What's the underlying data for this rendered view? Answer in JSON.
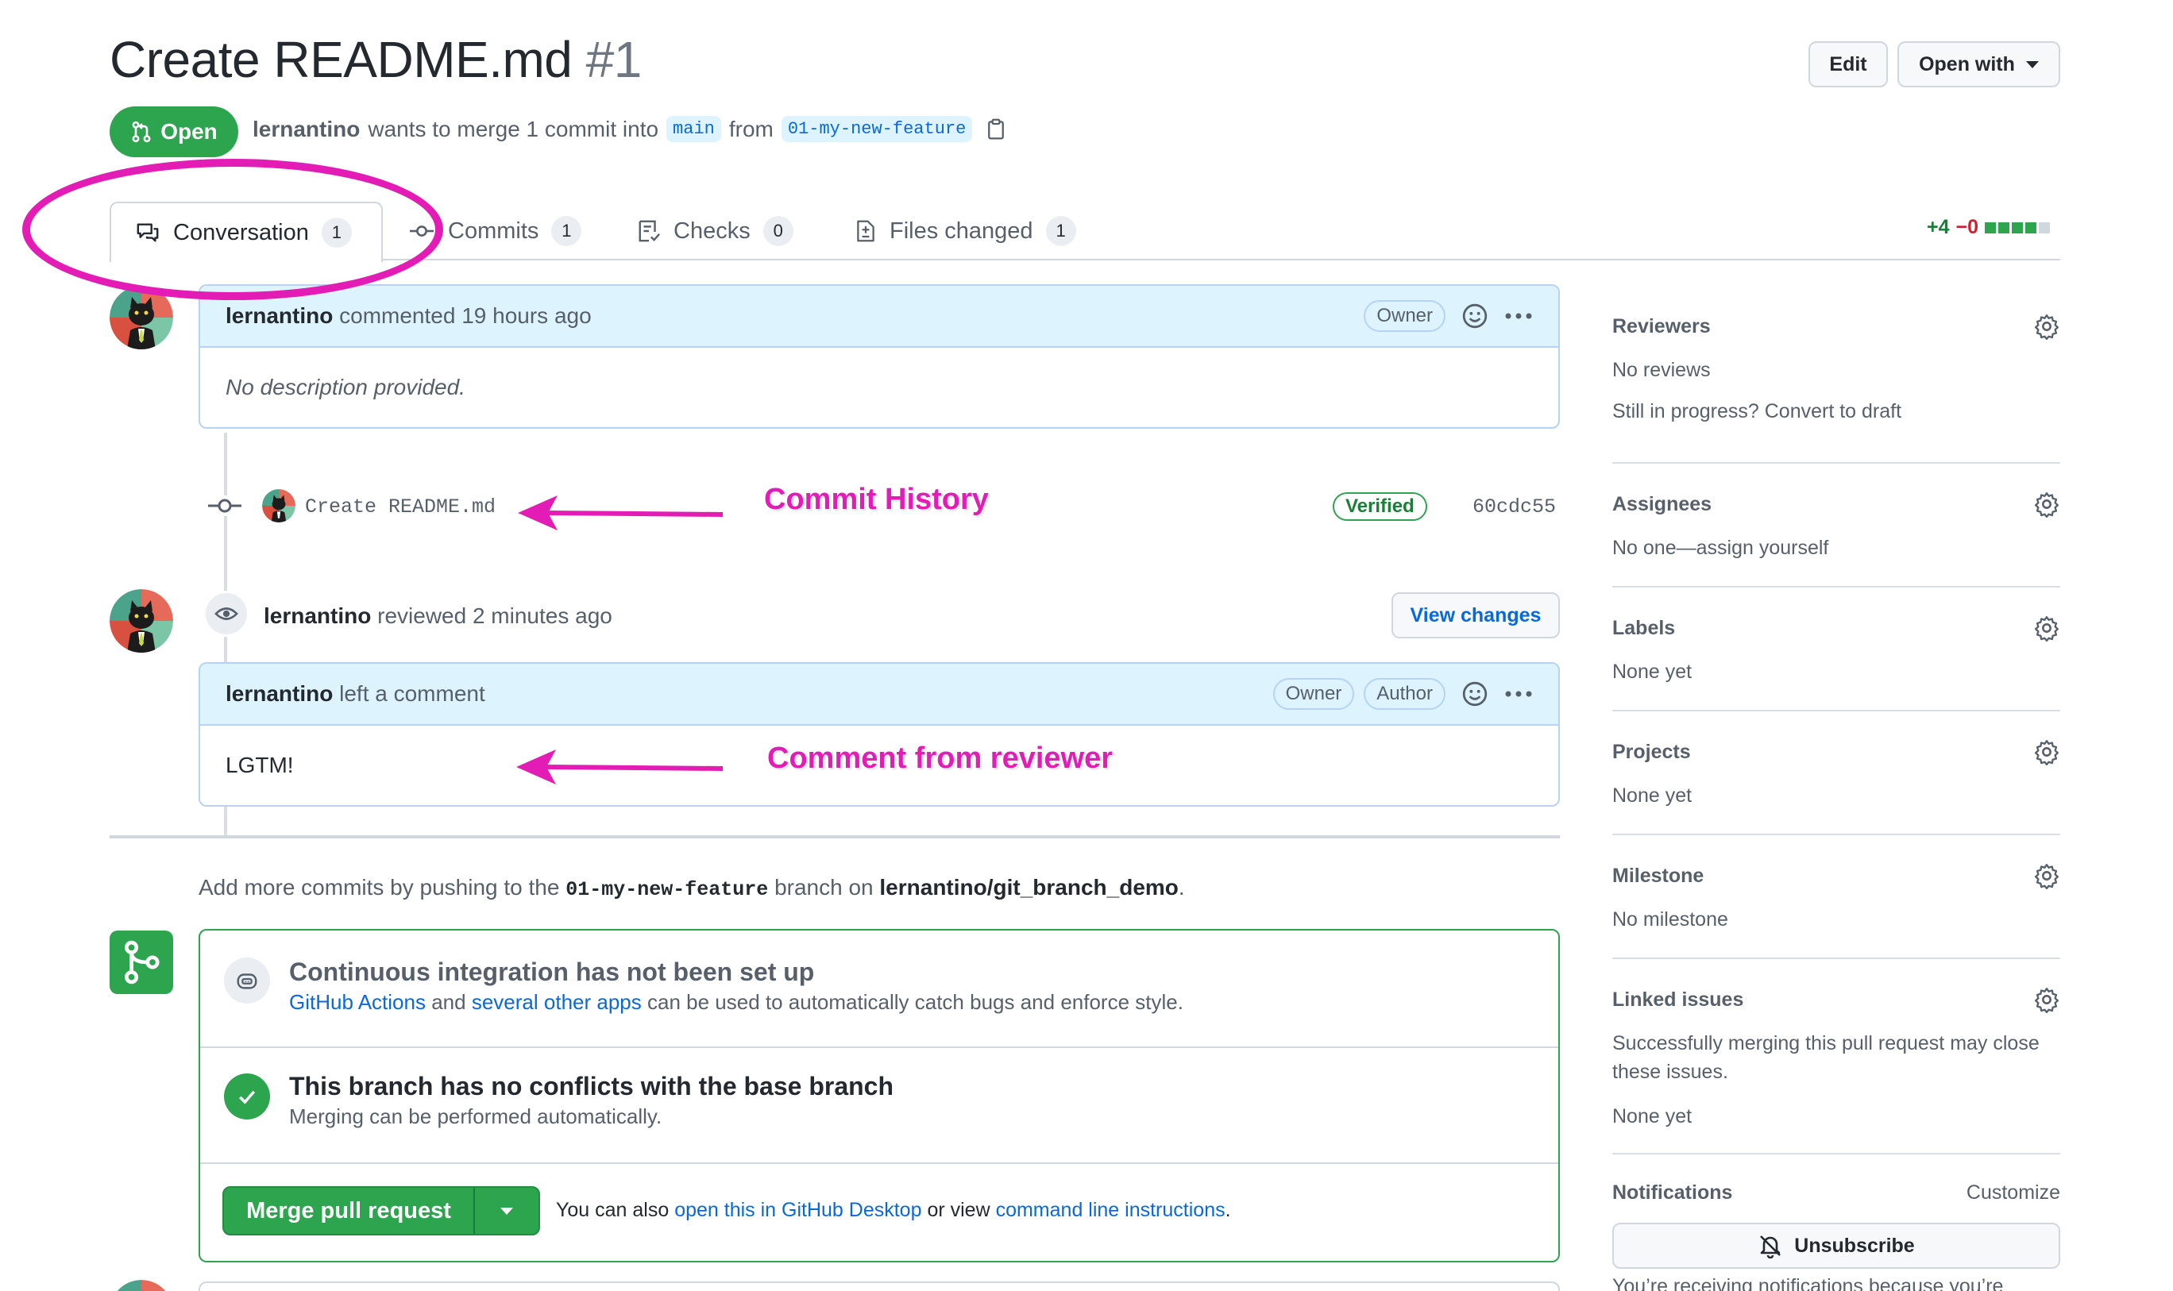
{
  "header": {
    "title": "Create README.md",
    "number": "#1",
    "edit_label": "Edit",
    "open_with_label": "Open with"
  },
  "pr_meta": {
    "state": "Open",
    "author": "lernantino",
    "text_merge": "wants to merge 1 commit into",
    "base_branch": "main",
    "text_from": "from",
    "head_branch": "01-my-new-feature"
  },
  "tabs": [
    {
      "label": "Conversation",
      "count": "1"
    },
    {
      "label": "Commits",
      "count": "1"
    },
    {
      "label": "Checks",
      "count": "0"
    },
    {
      "label": "Files changed",
      "count": "1"
    }
  ],
  "diffstat": {
    "additions": "+4",
    "deletions": "−0"
  },
  "first_comment": {
    "author": "lernantino",
    "action": "commented 19 hours ago",
    "role": "Owner",
    "body": "No description provided."
  },
  "commit": {
    "message": "Create README.md",
    "verified": "Verified",
    "sha": "60cdc55"
  },
  "review": {
    "author": "lernantino",
    "action": "reviewed 2 minutes ago",
    "view_changes": "View changes",
    "comment_author": "lernantino",
    "comment_action": "left a comment",
    "role_owner": "Owner",
    "role_author": "Author",
    "body": "LGTM!"
  },
  "annotations": {
    "commit_history": "Commit History",
    "comment_from_reviewer": "Comment from reviewer"
  },
  "add_commits": {
    "prefix": "Add more commits by pushing to the",
    "branch": "01-my-new-feature",
    "middle": "branch on",
    "repo": "lernantino/git_branch_demo",
    "suffix": "."
  },
  "merge": {
    "ci_title": "Continuous integration has not been set up",
    "ci_link1": "GitHub Actions",
    "ci_and": "and",
    "ci_link2": "several other apps",
    "ci_rest": "can be used to automatically catch bugs and enforce style.",
    "conflict_title": "This branch has no conflicts with the base branch",
    "conflict_sub": "Merging can be performed automatically.",
    "merge_button": "Merge pull request",
    "alt_prefix": "You can also",
    "alt_link1": "open this in GitHub Desktop",
    "alt_middle": "or view",
    "alt_link2": "command line instructions",
    "alt_suffix": "."
  },
  "sidebar": {
    "reviewers": {
      "title": "Reviewers",
      "line1": "No reviews",
      "line2": "Still in progress? Convert to draft"
    },
    "assignees": {
      "title": "Assignees",
      "line1": "No one—assign yourself"
    },
    "labels": {
      "title": "Labels",
      "line1": "None yet"
    },
    "projects": {
      "title": "Projects",
      "line1": "None yet"
    },
    "milestone": {
      "title": "Milestone",
      "line1": "No milestone"
    },
    "linked_issues": {
      "title": "Linked issues",
      "line1": "Successfully merging this pull request may close these issues.",
      "line2": "None yet"
    },
    "notifications": {
      "title": "Notifications",
      "customize": "Customize",
      "unsubscribe": "Unsubscribe",
      "reason": "You’re receiving notifications because you’re"
    }
  },
  "colors": {
    "open_green": "#2da44e",
    "link_blue": "#0969da",
    "annotation_magenta": "#e41cb6"
  }
}
